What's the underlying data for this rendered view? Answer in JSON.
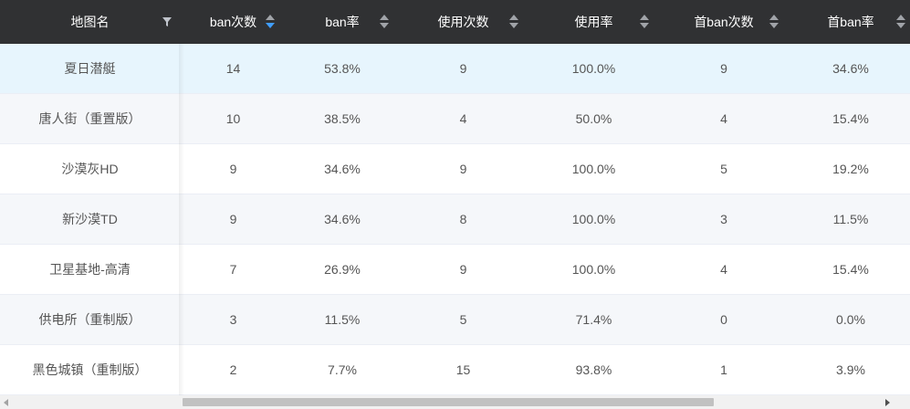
{
  "table": {
    "columns": [
      {
        "label": "地图名",
        "sortable": false,
        "filter": true
      },
      {
        "label": "ban次数",
        "sortable": true,
        "sort_state": "desc"
      },
      {
        "label": "ban率",
        "sortable": true,
        "sort_state": "none"
      },
      {
        "label": "使用次数",
        "sortable": true,
        "sort_state": "none"
      },
      {
        "label": "使用率",
        "sortable": true,
        "sort_state": "none"
      },
      {
        "label": "首ban次数",
        "sortable": true,
        "sort_state": "none"
      },
      {
        "label": "首ban率",
        "sortable": true,
        "sort_state": "none"
      }
    ],
    "rows": [
      [
        "夏日潜艇",
        "14",
        "53.8%",
        "9",
        "100.0%",
        "9",
        "34.6%"
      ],
      [
        "唐人街（重置版）",
        "10",
        "38.5%",
        "4",
        "50.0%",
        "4",
        "15.4%"
      ],
      [
        "沙漠灰HD",
        "9",
        "34.6%",
        "9",
        "100.0%",
        "5",
        "19.2%"
      ],
      [
        "新沙漠TD",
        "9",
        "34.6%",
        "8",
        "100.0%",
        "3",
        "11.5%"
      ],
      [
        "卫星基地-高清",
        "7",
        "26.9%",
        "9",
        "100.0%",
        "4",
        "15.4%"
      ],
      [
        "供电所（重制版）",
        "3",
        "11.5%",
        "5",
        "71.4%",
        "0",
        "0.0%"
      ],
      [
        "黑色城镇（重制版）",
        "2",
        "7.7%",
        "15",
        "93.8%",
        "1",
        "3.9%"
      ]
    ],
    "hovered_row": 0
  },
  "colors": {
    "header_bg": "#303133",
    "sort_active": "#409eff",
    "row_hover": "#e7f5fd",
    "row_stripe": "#f5f7fa"
  },
  "icons": {
    "filter": "filter-funnel-icon",
    "sort": "sort-caret-icon",
    "scroll_left": "arrow-left-icon",
    "scroll_right": "arrow-right-icon"
  }
}
